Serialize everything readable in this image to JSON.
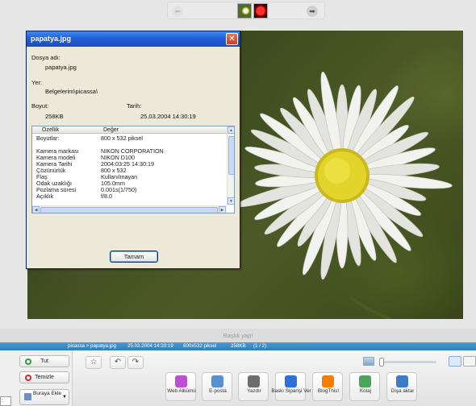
{
  "filmstrip": {
    "prev_icon": "arrow-left-icon",
    "next_icon": "arrow-right-icon",
    "prev_glyph": "⬅",
    "next_glyph": "➡"
  },
  "dialog": {
    "title": "papatya.jpg",
    "close_glyph": "✕",
    "fields": {
      "filename_label": "Dosya adı:",
      "filename_value": "papatya.jpg",
      "location_label": "Yer:",
      "location_value": "Belgelerim\\picassa\\",
      "size_label": "Boyut:",
      "size_value": "258KB",
      "date_label": "Tarih:",
      "date_value": "25.03.2004 14:30:19"
    },
    "table": {
      "col_property": "Özellik",
      "col_value": "Değer",
      "rows": [
        {
          "k": "Boyutlar:",
          "v": "800 x 532 piksel"
        },
        {
          "k": "",
          "v": ""
        },
        {
          "k": "Kamera markası",
          "v": "NIKON CORPORATION"
        },
        {
          "k": "Kamera modeli",
          "v": "NIKON D100"
        },
        {
          "k": "Kamera Tarihi",
          "v": "2004:03:25 14:30:19"
        },
        {
          "k": "Çözünürlük",
          "v": "800 x 532"
        },
        {
          "k": "Flaş",
          "v": "Kullanılmayan"
        },
        {
          "k": "Odak uzaklığı",
          "v": "105.0mm"
        },
        {
          "k": "Pozlama süresi",
          "v": "0.001s(1/750)"
        },
        {
          "k": "Açıklık",
          "v": "f/8.0"
        }
      ]
    },
    "ok_label": "Tamam"
  },
  "caption": {
    "placeholder": "Başlık yap!"
  },
  "infobar": {
    "path": "picassa > papatya.jpg",
    "date": "25.03.2004 14:30:19",
    "dimensions": "800x532 piksel",
    "size": "258KB",
    "position": "(1 / 2)"
  },
  "leftpanel": {
    "hold_label": "Tut",
    "clear_label": "Temizle",
    "add_here_label": "Buraya Ekle",
    "zoom_value": ": 3%",
    "hold_color": "#2e9b3a",
    "clear_color": "#d62828"
  },
  "toolbar": {
    "star_glyph": "☆",
    "rotate_left_glyph": "↶",
    "rotate_right_glyph": "↷",
    "buttons": [
      {
        "label": "Web Albümü",
        "icon": "web-album-icon",
        "color": "#c04dd6"
      },
      {
        "label": "E-posta",
        "icon": "email-icon",
        "color": "#5a8fd0"
      },
      {
        "label": "Yazdır",
        "icon": "printer-icon",
        "color": "#6d6d6d"
      },
      {
        "label": "Baskı Siparişi Ver",
        "icon": "order-prints-icon",
        "color": "#2f6fd8"
      },
      {
        "label": "BlogThis!",
        "icon": "blogger-icon",
        "color": "#f57d00"
      },
      {
        "label": "Kolaj",
        "icon": "collage-icon",
        "color": "#4aa55a"
      },
      {
        "label": "Dışa aktar",
        "icon": "export-icon",
        "color": "#3d7cc9"
      }
    ]
  }
}
